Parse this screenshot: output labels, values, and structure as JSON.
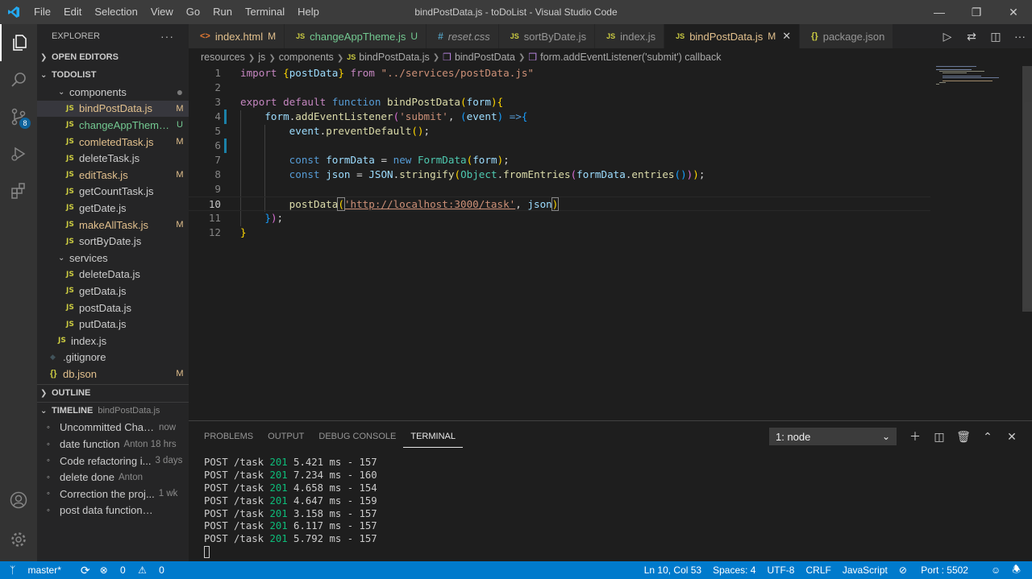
{
  "titlebar": {
    "menu": [
      "File",
      "Edit",
      "Selection",
      "View",
      "Go",
      "Run",
      "Terminal",
      "Help"
    ],
    "title": "bindPostData.js - toDoList - Visual Studio Code"
  },
  "activity": {
    "scm_badge": "8"
  },
  "sidebar": {
    "explorer_label": "EXPLORER",
    "open_editors_label": "OPEN EDITORS",
    "project_label": "TODOLIST",
    "tree": [
      {
        "type": "folder",
        "name": "components",
        "status": "●",
        "status_kind": "dot",
        "indent": 1
      },
      {
        "type": "js",
        "name": "bindPostData.js",
        "status": "M",
        "status_kind": "m",
        "indent": 2,
        "selected": true
      },
      {
        "type": "js",
        "name": "changeAppTheme...",
        "status": "U",
        "status_kind": "u",
        "indent": 2
      },
      {
        "type": "js",
        "name": "comletedTask.js",
        "status": "M",
        "status_kind": "m",
        "indent": 2
      },
      {
        "type": "js",
        "name": "deleteTask.js",
        "status": "",
        "status_kind": "",
        "indent": 2
      },
      {
        "type": "js",
        "name": "editTask.js",
        "status": "M",
        "status_kind": "m",
        "indent": 2
      },
      {
        "type": "js",
        "name": "getCountTask.js",
        "status": "",
        "status_kind": "",
        "indent": 2
      },
      {
        "type": "js",
        "name": "getDate.js",
        "status": "",
        "status_kind": "",
        "indent": 2
      },
      {
        "type": "js",
        "name": "makeAllTask.js",
        "status": "M",
        "status_kind": "m",
        "indent": 2
      },
      {
        "type": "js",
        "name": "sortByDate.js",
        "status": "",
        "status_kind": "",
        "indent": 2
      },
      {
        "type": "folder",
        "name": "services",
        "status": "",
        "status_kind": "",
        "indent": 1
      },
      {
        "type": "js",
        "name": "deleteData.js",
        "status": "",
        "status_kind": "",
        "indent": 2
      },
      {
        "type": "js",
        "name": "getData.js",
        "status": "",
        "status_kind": "",
        "indent": 2
      },
      {
        "type": "js",
        "name": "postData.js",
        "status": "",
        "status_kind": "",
        "indent": 2
      },
      {
        "type": "js",
        "name": "putData.js",
        "status": "",
        "status_kind": "",
        "indent": 2
      },
      {
        "type": "js",
        "name": "index.js",
        "status": "",
        "status_kind": "",
        "indent": 1
      },
      {
        "type": "git",
        "name": ".gitignore",
        "status": "",
        "status_kind": "",
        "indent": 0
      },
      {
        "type": "json",
        "name": "db.json",
        "status": "M",
        "status_kind": "m",
        "indent": 0
      }
    ],
    "outline_label": "OUTLINE",
    "timeline_label": "TIMELINE",
    "timeline_file": "bindPostData.js",
    "timeline": [
      {
        "msg": "Uncommitted Chan...",
        "meta": "now"
      },
      {
        "msg": "date function",
        "meta": "Anton 18 hrs"
      },
      {
        "msg": "Code refactoring i...",
        "meta": "3 days"
      },
      {
        "msg": "delete done",
        "meta": "Anton"
      },
      {
        "msg": "Correction the proj...",
        "meta": "1 wk"
      },
      {
        "msg": "post data function don...",
        "meta": ""
      }
    ]
  },
  "tabs": [
    {
      "icon": "<>",
      "icon_kind": "html",
      "label": "index.html",
      "label_kind": "mod",
      "status": "M",
      "status_kind": "m"
    },
    {
      "icon": "JS",
      "icon_kind": "js",
      "label": "changeAppTheme.js",
      "label_kind": "unt",
      "status": "U",
      "status_kind": "u"
    },
    {
      "icon": "#",
      "icon_kind": "css",
      "label": "reset.css",
      "label_kind": "it",
      "status": "",
      "status_kind": ""
    },
    {
      "icon": "JS",
      "icon_kind": "js",
      "label": "sortByDate.js",
      "label_kind": "",
      "status": "",
      "status_kind": ""
    },
    {
      "icon": "JS",
      "icon_kind": "js",
      "label": "index.js",
      "label_kind": "",
      "status": "",
      "status_kind": ""
    },
    {
      "icon": "JS",
      "icon_kind": "js",
      "label": "bindPostData.js",
      "label_kind": "mod",
      "status": "M",
      "status_kind": "m",
      "active": true
    },
    {
      "icon": "{}",
      "icon_kind": "json",
      "label": "package.json",
      "label_kind": "",
      "status": "",
      "status_kind": ""
    }
  ],
  "breadcrumb": {
    "parts": [
      "resources",
      "js",
      "components"
    ],
    "file": "bindPostData.js",
    "fn": "bindPostData",
    "callback": "form.addEventListener('submit') callback"
  },
  "editor": {
    "current_line": 10,
    "lines": [
      {
        "n": "1",
        "html": "<span class='kw2'>import</span> <span class='br'>{</span><span class='var'>postData</span><span class='br'>}</span> <span class='kw2'>from</span> <span class='str'>\"../services/postData.js\"</span>"
      },
      {
        "n": "2",
        "html": ""
      },
      {
        "n": "3",
        "html": "<span class='kw2'>export</span> <span class='kw2'>default</span> <span class='kw'>function</span> <span class='fn'>bindPostData</span><span class='br'>(</span><span class='var'>form</span><span class='br'>){</span>"
      },
      {
        "n": "4",
        "html": "    <span class='var'>form</span>.<span class='fn'>addEventListener</span><span class='br2'>(</span><span class='str'>'submit'</span>, <span class='br3'>(</span><span class='var'>event</span><span class='br3'>)</span> <span class='kw'>=&gt;</span><span class='br3'>{</span>"
      },
      {
        "n": "5",
        "html": "        <span class='var'>event</span>.<span class='fn'>preventDefault</span><span class='br'>()</span>;"
      },
      {
        "n": "6",
        "html": ""
      },
      {
        "n": "7",
        "html": "        <span class='kw'>const</span> <span class='var'>formData</span> = <span class='kw'>new</span> <span class='cls'>FormData</span><span class='br'>(</span><span class='var'>form</span><span class='br'>)</span>;"
      },
      {
        "n": "8",
        "html": "        <span class='kw'>const</span> <span class='var'>json</span> = <span class='var'>JSON</span>.<span class='fn'>stringify</span><span class='br'>(</span><span class='cls'>Object</span>.<span class='fn'>fromEntries</span><span class='br2'>(</span><span class='var'>formData</span>.<span class='fn'>entries</span><span class='br3'>()</span><span class='br2'>)</span><span class='br'>)</span>;"
      },
      {
        "n": "9",
        "html": ""
      },
      {
        "n": "10",
        "html": "        <span class='fn'>postData</span><span class='br bm'>(</span><span class='strurl'>'http://localhost:3000/task'</span>, <span class='var'>json</span><span class='br bm'>)</span>"
      },
      {
        "n": "11",
        "html": "    <span class='br3'>}</span><span class='br2'>)</span>;"
      },
      {
        "n": "12",
        "html": "<span class='br'>}</span>"
      }
    ]
  },
  "panel": {
    "tabs": [
      "PROBLEMS",
      "OUTPUT",
      "DEBUG CONSOLE",
      "TERMINAL"
    ],
    "active_tab": "TERMINAL",
    "terminal_select": "1: node",
    "terminal_lines": [
      {
        "pre": "POST /task ",
        "code": "201",
        "post": " 5.421 ms - 157"
      },
      {
        "pre": "POST /task ",
        "code": "201",
        "post": " 7.234 ms - 160"
      },
      {
        "pre": "POST /task ",
        "code": "201",
        "post": " 4.658 ms - 154"
      },
      {
        "pre": "POST /task ",
        "code": "201",
        "post": " 4.647 ms - 159"
      },
      {
        "pre": "POST /task ",
        "code": "201",
        "post": " 3.158 ms - 157"
      },
      {
        "pre": "POST /task ",
        "code": "201",
        "post": " 6.117 ms - 157"
      },
      {
        "pre": "POST /task ",
        "code": "201",
        "post": " 5.792 ms - 157"
      }
    ]
  },
  "statusbar": {
    "branch": "master*",
    "errors": "0",
    "warnings": "0",
    "position": "Ln 10, Col 53",
    "spaces": "Spaces: 4",
    "encoding": "UTF-8",
    "eol": "CRLF",
    "language": "JavaScript",
    "port": "Port : 5502"
  }
}
